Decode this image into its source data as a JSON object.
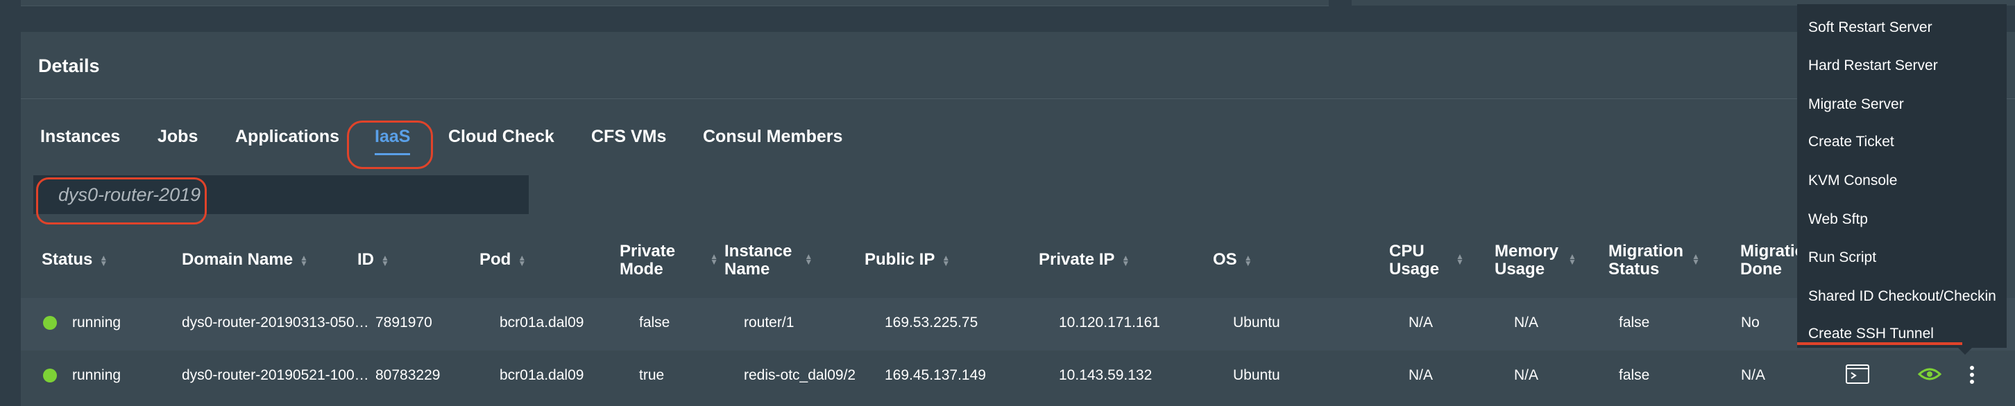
{
  "panel": {
    "title": "Details"
  },
  "tabs": [
    {
      "label": "Instances",
      "active": false
    },
    {
      "label": "Jobs",
      "active": false
    },
    {
      "label": "Applications",
      "active": false
    },
    {
      "label": "IaaS",
      "active": true
    },
    {
      "label": "Cloud Check",
      "active": false
    },
    {
      "label": "CFS VMs",
      "active": false
    },
    {
      "label": "Consul Members",
      "active": false
    }
  ],
  "search": {
    "value": "dys0-router-2019"
  },
  "table": {
    "headers": [
      "Status",
      "Domain Name",
      "ID",
      "Pod",
      "Private\nMode",
      "Instance\nName",
      "Public IP",
      "Private IP",
      "OS",
      "CPU\nUsage",
      "Memory\nUsage",
      "Migration\nStatus",
      "Migration\nDone"
    ],
    "rows": [
      {
        "status": "running",
        "domain": "dys0-router-20190313-050…",
        "id": "7891970",
        "pod": "bcr01a.dal09",
        "private_mode": "false",
        "instance_name": "router/1",
        "public_ip": "169.53.225.75",
        "private_ip": "10.120.171.161",
        "os": "Ubuntu",
        "cpu": "N/A",
        "memory": "N/A",
        "migration_status": "false",
        "migration_done": "No"
      },
      {
        "status": "running",
        "domain": "dys0-router-20190521-100…",
        "id": "80783229",
        "pod": "bcr01a.dal09",
        "private_mode": "true",
        "instance_name": "redis-otc_dal09/2",
        "public_ip": "169.45.137.149",
        "private_ip": "10.143.59.132",
        "os": "Ubuntu",
        "cpu": "N/A",
        "memory": "N/A",
        "migration_status": "false",
        "migration_done": "N/A"
      }
    ]
  },
  "menu": {
    "items": [
      "Soft Restart Server",
      "Hard Restart Server",
      "Migrate Server",
      "Create Ticket",
      "KVM Console",
      "Web Sftp",
      "Run Script",
      "Shared ID Checkout/Checkin",
      "Create SSH Tunnel"
    ]
  },
  "icons": {
    "terminal": "terminal-icon",
    "view": "eye-icon",
    "more": "overflow-menu-icon"
  },
  "colors": {
    "accent": "#5aa0e8",
    "highlight": "#e0432a",
    "status_running": "#7dd136",
    "view_icon": "#7dd136"
  }
}
